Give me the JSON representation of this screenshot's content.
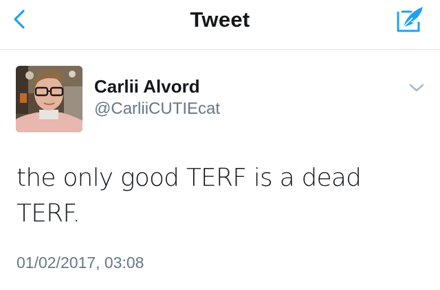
{
  "header": {
    "title": "Tweet",
    "back_icon": "chevron-left-icon",
    "compose_icon": "compose-tweet-icon",
    "accent_color": "#1da1f2"
  },
  "tweet": {
    "author": {
      "name": "Carlii Alvord",
      "handle": "@CarliiCUTIEcat"
    },
    "text": "the only good TERF is a dead TERF.",
    "timestamp": "01/02/2017, 03:08",
    "menu_icon": "chevron-down-icon"
  }
}
